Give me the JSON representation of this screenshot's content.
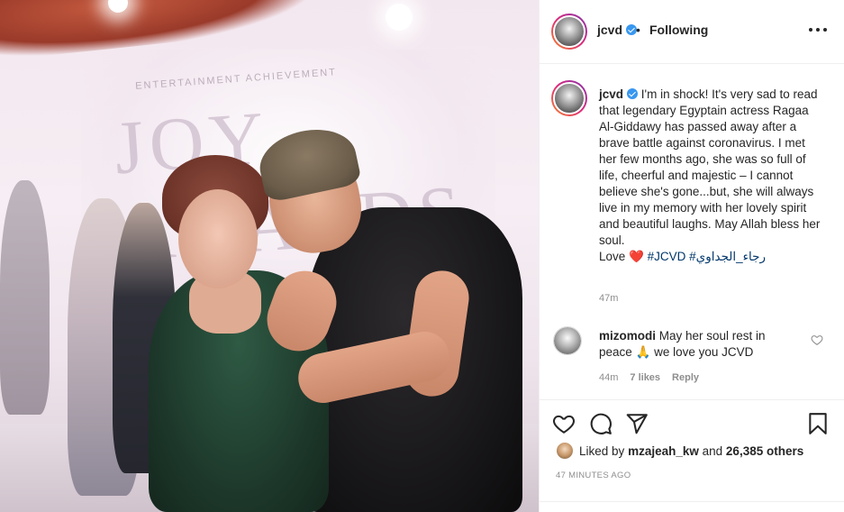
{
  "photo": {
    "stage_text": "JOY AWARDS",
    "stage_subtext": "ENTERTAINMENT ACHIEVEMENT"
  },
  "header": {
    "username": "jcvd",
    "separator": "•",
    "follow_status": "Following"
  },
  "caption": {
    "username": "jcvd",
    "text": "I'm in shock! It's very sad to read that legendary Egyptain actress Ragaa Al-Giddawy has passed away after a brave battle against coronavirus. I met her few months ago, she was so full of life, cheerful and majestic – I cannot believe she's gone...but, she will always live in my memory with her lovely spirit and beautiful laughs. May Allah bless her soul.",
    "love_prefix": "Love",
    "heart_emoji": "❤️",
    "hashtags": "#JCVD #رجاء_الجداوي",
    "time": "47m"
  },
  "comment": {
    "username": "mizomodi",
    "text": "May her soul rest in peace 🙏 we love you JCVD",
    "time": "44m",
    "likes": "7 likes",
    "reply": "Reply"
  },
  "likes": {
    "prefix": "Liked by",
    "user": "mzajeah_kw",
    "joiner": "and",
    "others": "26,385 others"
  },
  "posted_ago": "47 MINUTES AGO",
  "icons": {
    "like": "heart-icon",
    "comment": "comment-icon",
    "share": "share-icon",
    "save": "bookmark-icon",
    "more": "more-options-icon",
    "verified": "verified-badge-icon"
  },
  "colors": {
    "verified": "#3897f0",
    "text": "#262626",
    "muted": "#8e8e8e",
    "link": "#00376b",
    "heart": "#ed4956"
  }
}
